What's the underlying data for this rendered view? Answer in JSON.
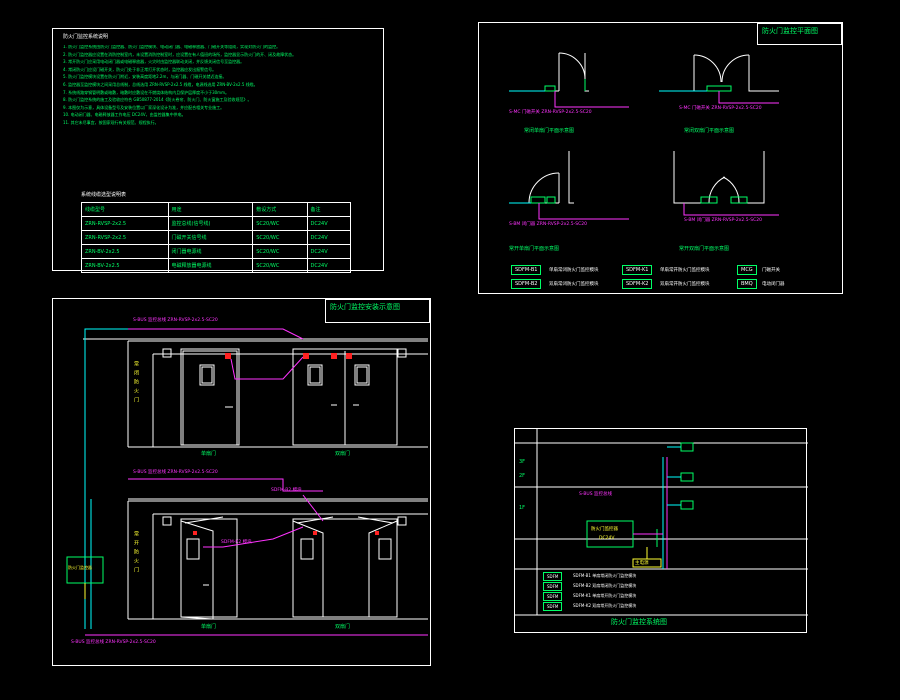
{
  "notes": {
    "heading": "防火门监控系统说明",
    "lines": [
      "1. 防火门监控系统由防火门监控器、防火门监控模块、电动闭门器、电磁释放器、门磁开关等组成，实现对防火门的监控。",
      "2. 防火门监控器应设置在消防控制室内，未设置消防控制室时，应设置在有人值班的场所，监控器显示防火门的开、闭及故障状态。",
      "3. 常开防火门应采用电动闭门器或电磁释放器，火灾时由监控器联动关闭，并反馈关闭信号至监控器。",
      "4. 常闭防火门应设门磁开关，防火门处于非正常打开状态时，监控器应发出报警信号。",
      "5. 防火门监控模块设置在防火门附近，安装高度距地2.2m，与闭门器、门磁开关就近连接。",
      "6. 监控器至监控模块之间采用总线制，总线选用 ZRN-RVSP-2x2.5 线缆，电源线选用 ZRN-BV-2x2.5 线缆。",
      "7. 系统线路穿钢管明敷或暗敷，暗敷时应敷设在不燃烧体结构内且保护层厚度不小于30mm。",
      "8. 防火门监控系统的施工及验收应符合 GB50877-2014《防火卷帘、防火门、防火窗施工及验收规范》。",
      "9. 本图仅为示意，具体设备型号及安装位置以厂家深化设计为准，并应配合相关专业施工。",
      "10. 电动闭门器、电磁释放器工作电压 DC24V，由监控器集中供电。",
      "11. 其它未尽事宜，按国家现行有关规范、规程执行。"
    ],
    "table_title": "系统线缆选型说明表",
    "table_headers": [
      "线缆型号",
      "用途",
      "敷设方式",
      "备注"
    ],
    "table_rows": [
      [
        "ZRN-RVSP-2x2.5",
        "监控总线(信号线)",
        "SC20/WC",
        "DC24V"
      ],
      [
        "ZRN-RVSP-2x2.5",
        "门磁开关信号线",
        "SC20/WC",
        "DC24V"
      ],
      [
        "ZRN-BV-2x2.5",
        "闭门器电源线",
        "SC20/WC",
        "DC24V"
      ],
      [
        "ZRN-BV-2x2.5",
        "电磁释放器电源线",
        "SC20/WC",
        "DC24V"
      ]
    ]
  },
  "plan": {
    "title": "防火门监控平面图",
    "labels": [
      "常闭单扇门平面示意图",
      "常闭双扇门平面示意图",
      "常开单扇门平面示意图",
      "常开双扇门平面示意图"
    ],
    "wire_notes": [
      "S-MC 门磁开关 ZRN-RVSP-2x2.5-SC20",
      "S-MC 门磁开关 ZRN-RVSP-2x2.5-SC20",
      "S-BM 闭门器 ZRN-RVSP-2x2.5-SC20",
      "S-BM 闭门器 ZRN-RVSP-2x2.5-SC20"
    ],
    "legend": [
      {
        "tag": "SDFM-B1",
        "desc": "单扇常闭防火门监控模块"
      },
      {
        "tag": "SDFM-B2",
        "desc": "双扇常闭防火门监控模块"
      },
      {
        "tag": "SDFM-K1",
        "desc": "单扇常开防火门监控模块"
      },
      {
        "tag": "SDFM-K2",
        "desc": "双扇常开防火门监控模块"
      },
      {
        "tag": "MCG",
        "desc": "门磁开关"
      },
      {
        "tag": "BMQ",
        "desc": "电动闭门器"
      }
    ]
  },
  "elevation": {
    "title": "防火门监控安装示意图",
    "top_wire": "S-BUS 监控总线 ZRN-RVSP-2x2.5-SC20",
    "top_label_left": "单扇门",
    "top_label_right": "双扇门",
    "bottom_label_left": "单扇门",
    "bottom_label_right": "双扇门",
    "side_text_top": "常闭防火门",
    "side_text_bottom": "常开防火门",
    "controller_label": "防火门监控器",
    "mid_wire": "S-BUS 监控总线 ZRN-RVSP-2x2.5-SC20",
    "bottom_wire": "S-BUS 监控总线 ZRN-RVSP-2x2.5-SC20",
    "closer_label": "SDFM-K2 模块",
    "door_wire_label": "SDFM-B2 模块"
  },
  "system": {
    "title": "防火门监控系统图",
    "floor_labels": [
      "3F",
      "2F",
      "1F"
    ],
    "controller": "防火门监控器",
    "controller_sub": "DC24V",
    "power_label": "主电源",
    "bus_note": "S-BUS 监控总线",
    "legend": [
      {
        "tag": "SDFM",
        "desc": "SDFM-B1 单扇常闭防火门监控模块"
      },
      {
        "tag": "SDFM",
        "desc": "SDFM-B2 双扇常闭防火门监控模块"
      },
      {
        "tag": "SDFM",
        "desc": "SDFM-K1 单扇常开防火门监控模块"
      },
      {
        "tag": "SDFM",
        "desc": "SDFM-K2 双扇常开防火门监控模块"
      }
    ]
  }
}
